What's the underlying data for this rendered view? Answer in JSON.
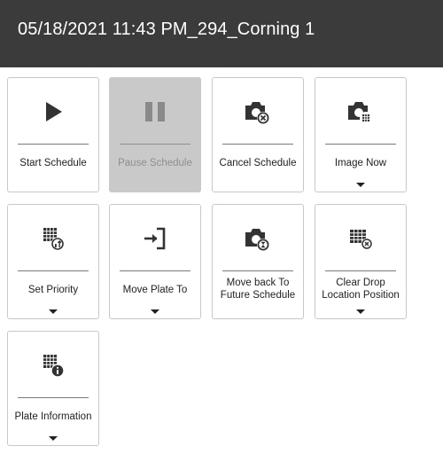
{
  "header": {
    "title": "05/18/2021 11:43 PM_294_Corning 1"
  },
  "actions": [
    {
      "label": "Start Schedule",
      "icon": "play-icon",
      "enabled": true,
      "has_dropdown": false
    },
    {
      "label": "Pause Schedule",
      "icon": "pause-icon",
      "enabled": false,
      "has_dropdown": false
    },
    {
      "label": "Cancel Schedule",
      "icon": "camera-cancel-icon",
      "enabled": true,
      "has_dropdown": false
    },
    {
      "label": "Image Now",
      "icon": "camera-grid-icon",
      "enabled": true,
      "has_dropdown": true
    },
    {
      "label": "Set Priority",
      "icon": "grid-priority-icon",
      "enabled": true,
      "has_dropdown": true
    },
    {
      "label": "Move Plate To",
      "icon": "move-to-icon",
      "enabled": true,
      "has_dropdown": true
    },
    {
      "label": "Move back To Future Schedule",
      "icon": "camera-hourglass-icon",
      "enabled": true,
      "has_dropdown": false
    },
    {
      "label": "Clear Drop Location Position",
      "icon": "grid-clear-icon",
      "enabled": true,
      "has_dropdown": true
    },
    {
      "label": "Plate Information",
      "icon": "grid-info-icon",
      "enabled": true,
      "has_dropdown": true
    }
  ],
  "colors": {
    "header_bg": "#3b3b3b",
    "disabled_tile_bg": "#c9c9c9",
    "icon": "#333333"
  }
}
